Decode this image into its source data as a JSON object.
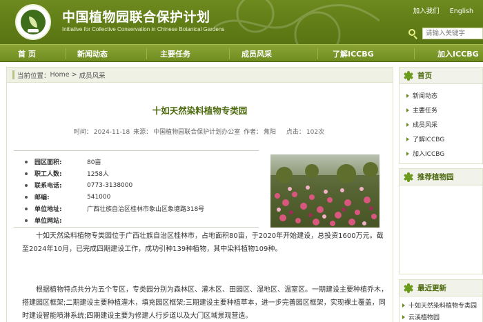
{
  "header": {
    "title_cn": "中国植物园联合保护计划",
    "title_en": "Initiative for Collective Conservation in Chinese Botanical Gardens",
    "join_link": "加入我们",
    "english_link": "English",
    "search_placeholder": "请输入关键字"
  },
  "nav": [
    {
      "label": "首  页"
    },
    {
      "label": "新闻动态"
    },
    {
      "label": "主要任务"
    },
    {
      "label": "成员风采"
    },
    {
      "label": "了解ICCBG"
    },
    {
      "label": "加入ICCBG"
    }
  ],
  "breadcrumb": {
    "prefix": "当前位置：",
    "home": "Home",
    "sep": " > ",
    "current": "成员风采"
  },
  "article": {
    "title": "十如天然染料植物专类园",
    "meta": {
      "time_label": "时间：",
      "time": "2024-11-18",
      "source_label": "来源：",
      "source": "中国植物园联合保护计划办公室",
      "author_label": "作者：",
      "author": "焦阳",
      "clicks_label": "点击：",
      "clicks": "102次"
    },
    "info": [
      {
        "label": "园区面积:",
        "value": "80亩"
      },
      {
        "label": "职工人数:",
        "value": "1258人"
      },
      {
        "label": "联系电话:",
        "value": "0773-3138000"
      },
      {
        "label": "邮编:",
        "value": "541000"
      },
      {
        "label": "单位地址:",
        "value": "广西壮族自治区桂林市象山区象塘路318号"
      },
      {
        "label": "单位网站:",
        "value": ""
      }
    ],
    "paragraphs": [
      "十如天然染料植物专类园位于广西壮族自治区桂林市，占地面积80亩，于2020年开始建设，总投资1600万元。截至2024年10月，已完成四期建设工作，成功引种139种植物，其中染料植物109种。",
      "根据植物特点共分为五个专区，专类园分别为森林区、灌木区、田园区、湿地区、温室区。一期建设主要种植乔木，搭建园区框架;二期建设主要种植灌木，填充园区框架;三期建设主要种植草本，进一步完善园区框架，实现裸土覆盖，同时建设智能喷淋系统;四期建设主要为修建人行步道以及大门区域景观营造。"
    ]
  },
  "sidebar": {
    "home": {
      "title": "首页",
      "items": [
        "新闻动态",
        "主要任务",
        "成员风采",
        "了解ICCBG",
        "加入ICCBG"
      ]
    },
    "recommend": {
      "title": "推荐植物园"
    },
    "latest": {
      "title": "最近更新",
      "items": [
        "十如天然染料植物专类园",
        "云溪植物园"
      ]
    }
  },
  "colors": {
    "header_green": "#5f7c16",
    "nav_green": "#7c9829",
    "title_green": "#4d6a0f"
  }
}
